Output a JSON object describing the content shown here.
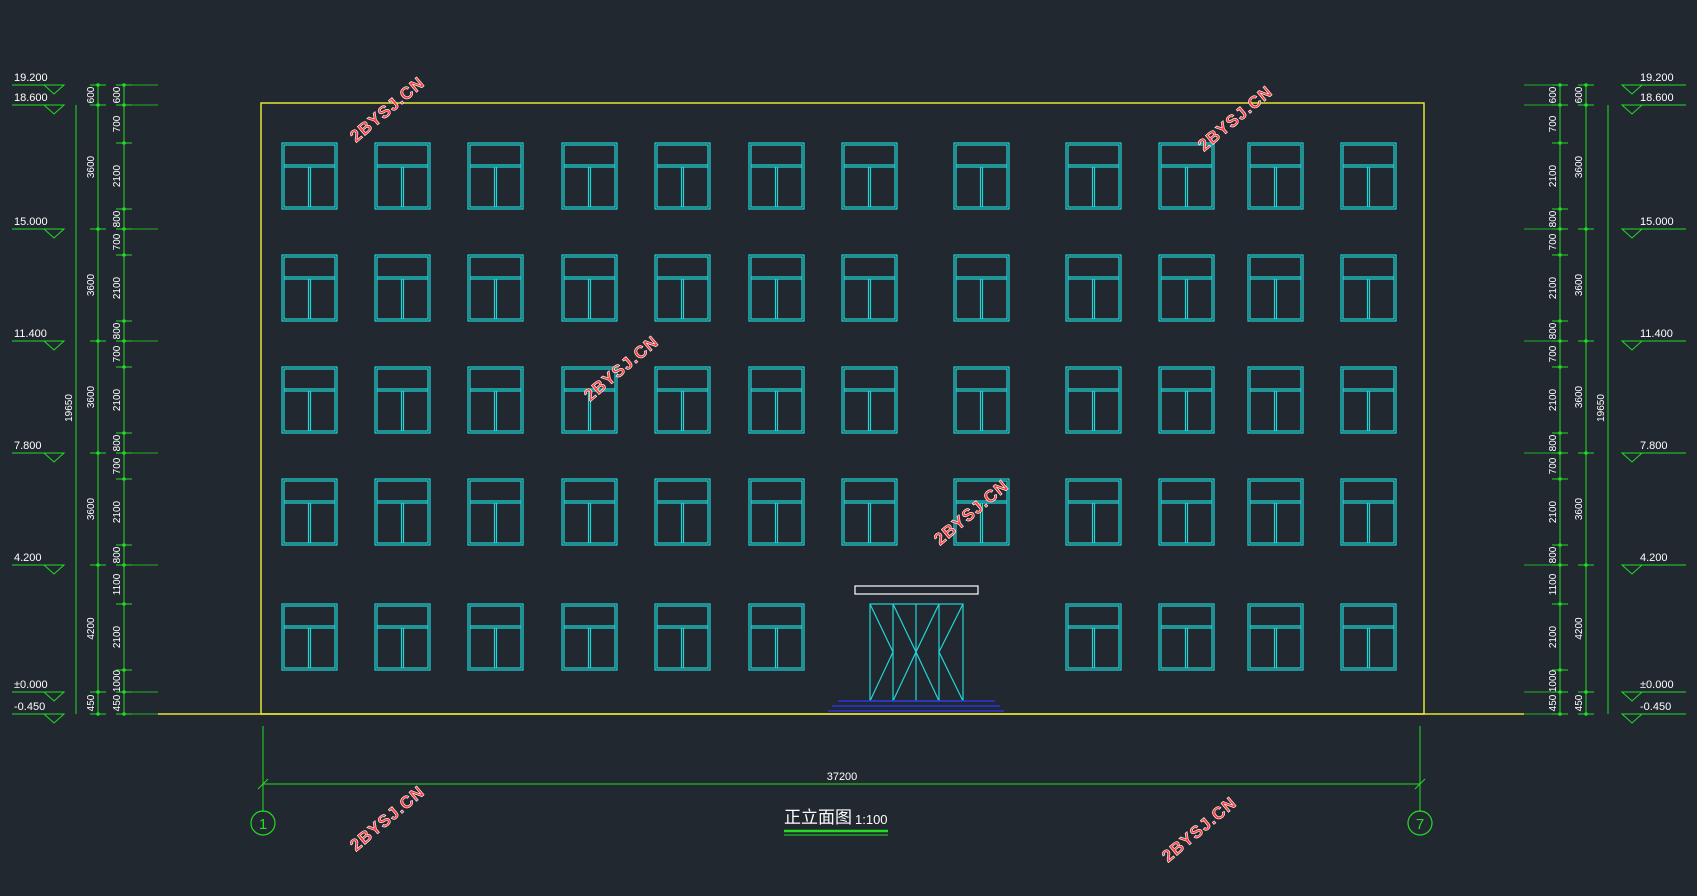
{
  "drawing": {
    "title": "正立面图",
    "scale": "1:100",
    "total_width_dim": "37200",
    "axis_start": "1",
    "axis_end": "7",
    "total_height_dim": "19650"
  },
  "levels": [
    {
      "label": "19.200"
    },
    {
      "label": "18.600"
    },
    {
      "label": "15.000"
    },
    {
      "label": "11.400"
    },
    {
      "label": "7.800"
    },
    {
      "label": "4.200"
    },
    {
      "label": "±0.000"
    },
    {
      "label": "-0.450"
    }
  ],
  "outer_dims": [
    "600",
    "3600",
    "3600",
    "3600",
    "3600",
    "4200",
    "450"
  ],
  "inner_dims": [
    "600",
    "700",
    "2100",
    "800",
    "700",
    "2100",
    "800",
    "700",
    "2100",
    "800",
    "700",
    "2100",
    "800",
    "1100",
    "2100",
    "1000",
    "450"
  ],
  "watermarks": [
    "2BYSJ.CN",
    "2BYSJ.CN",
    "2BYSJ.CN",
    "2BYSJ.CN",
    "2BYSJ.CN",
    "2BYSJ.CN"
  ],
  "colors": {
    "background": "#212830",
    "outline": "#e6e632",
    "windows": "#21d6d6",
    "dimensions": "#22dd22",
    "text": "#ffffff",
    "watermark": "#ff3b3b",
    "steps": "#2b34d9"
  }
}
